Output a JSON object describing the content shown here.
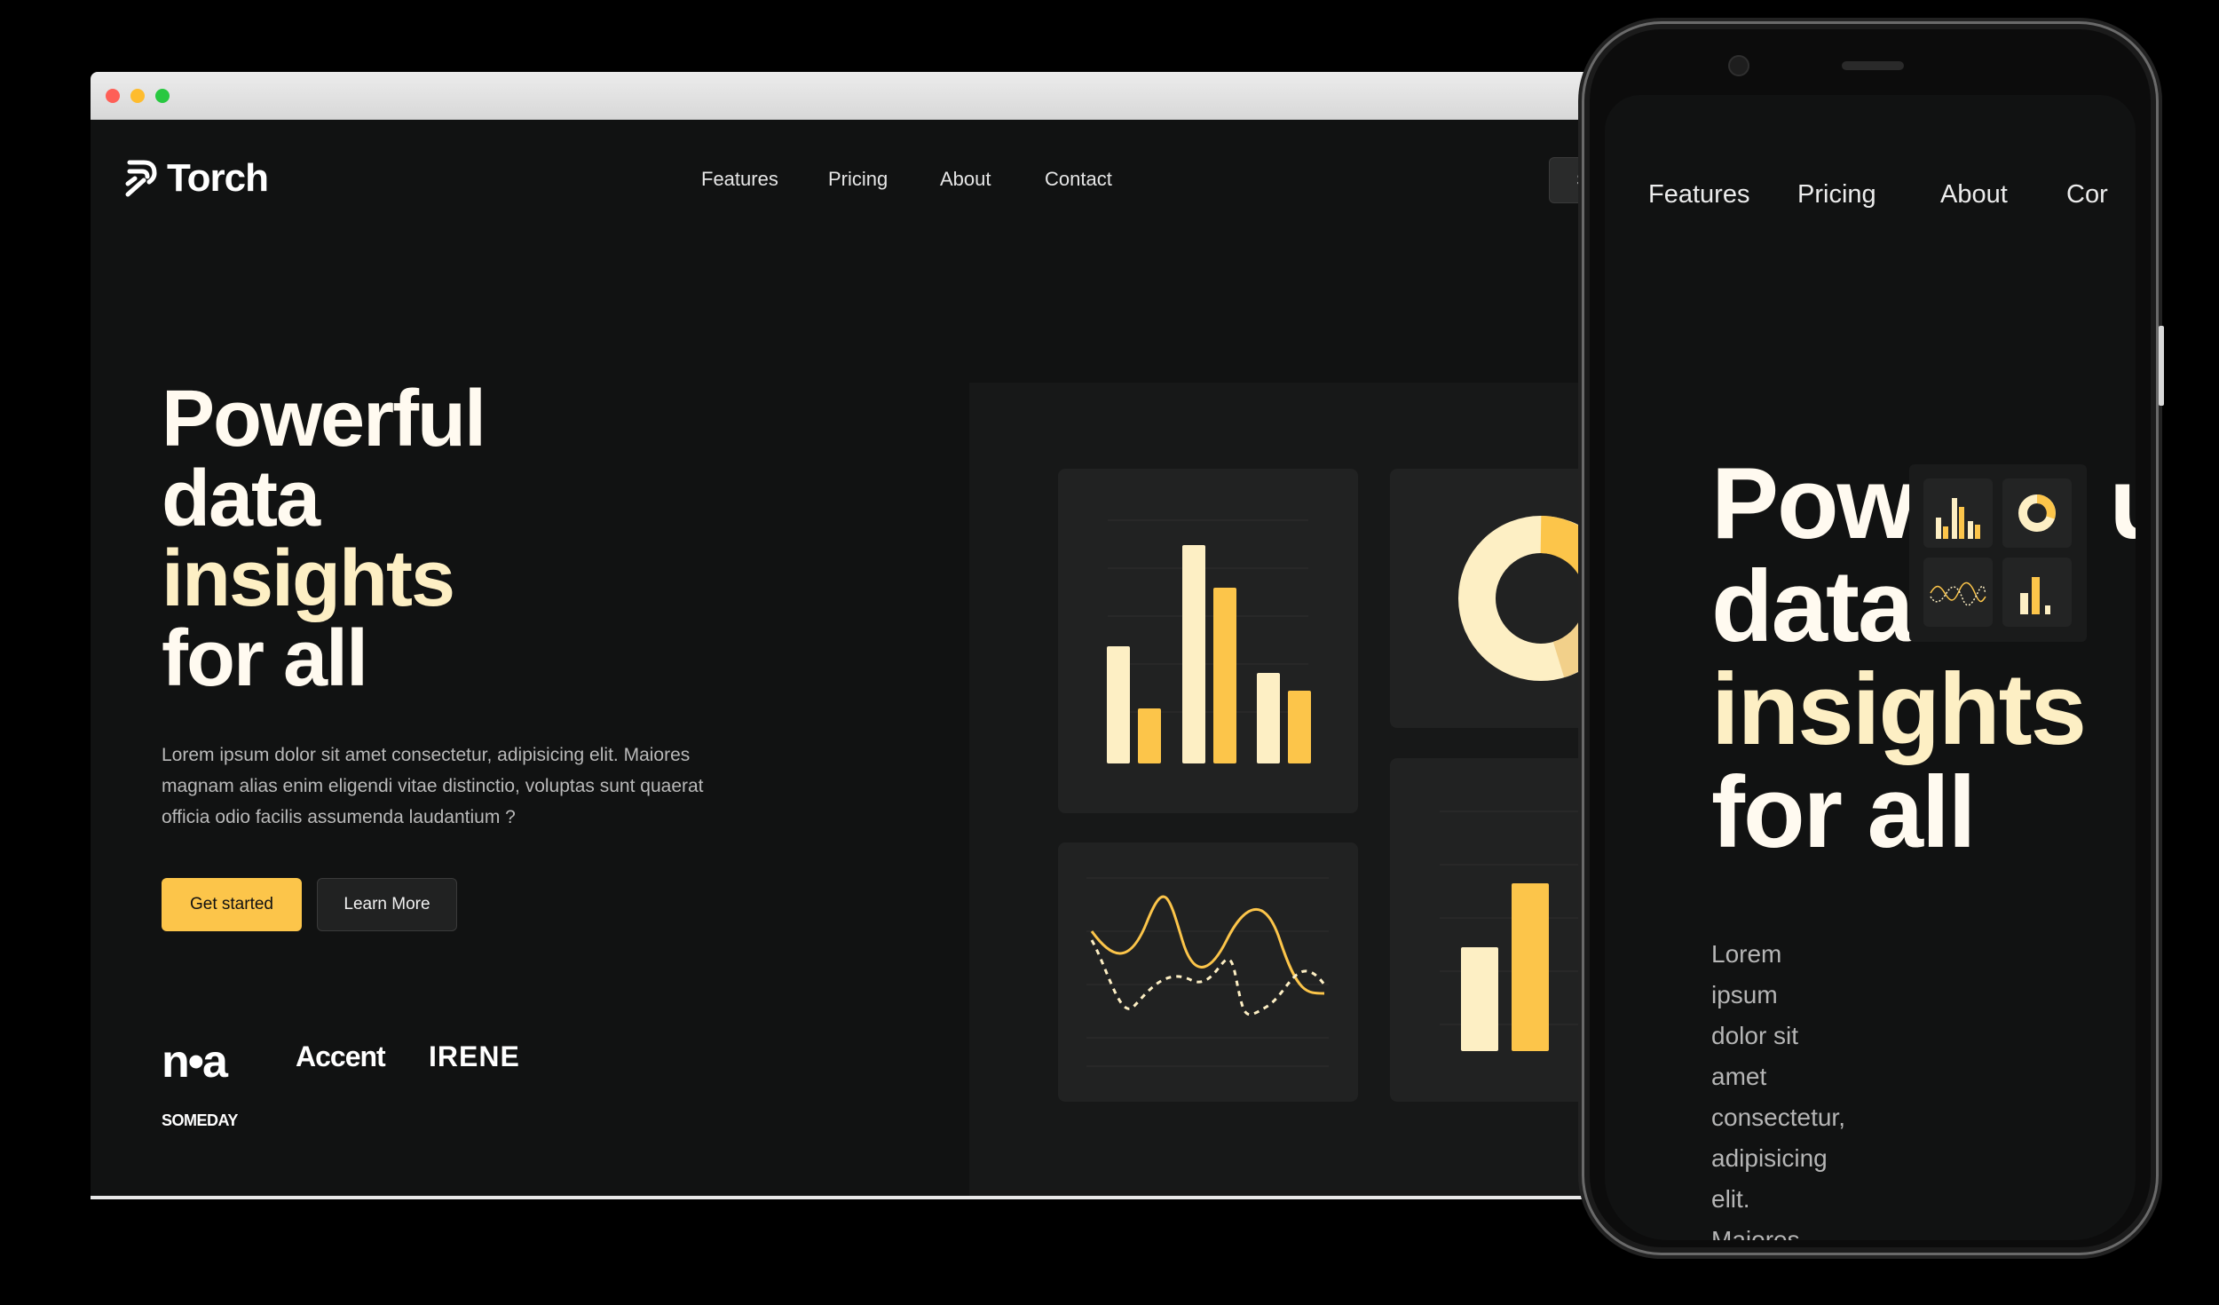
{
  "brand": {
    "name": "Torch"
  },
  "nav": {
    "items": [
      "Features",
      "Pricing",
      "About",
      "Contact"
    ],
    "cta_partial": "S"
  },
  "hero": {
    "title_lines": [
      "Powerful",
      "data",
      "insights",
      "for all"
    ],
    "description": "Lorem ipsum dolor sit amet consectetur, adipisicing elit. Maiores magnam alias enim eligendi vitae distinctio, voluptas sunt quaerat officia odio facilis assumenda laudantium ?",
    "primary_button": "Get started",
    "secondary_button": "Learn More"
  },
  "partner_logos": [
    "n•a",
    "Accent",
    "IRENE",
    "SOMEDAY"
  ],
  "phone": {
    "nav_items": [
      "Features",
      "Pricing",
      "About",
      "Cor"
    ],
    "title_lines": [
      "Pow",
      "ul",
      "data",
      "insights",
      "for all"
    ],
    "desc_lines": [
      "Lorem",
      "ipsum",
      "dolor sit",
      "amet",
      "consectetur,",
      "adipisicing",
      "elit.",
      "Maiores"
    ]
  },
  "colors": {
    "background": "#000000",
    "page": "#111212",
    "accent": "#fcc54a",
    "cream": "#fdefc4",
    "card": "#212222"
  }
}
